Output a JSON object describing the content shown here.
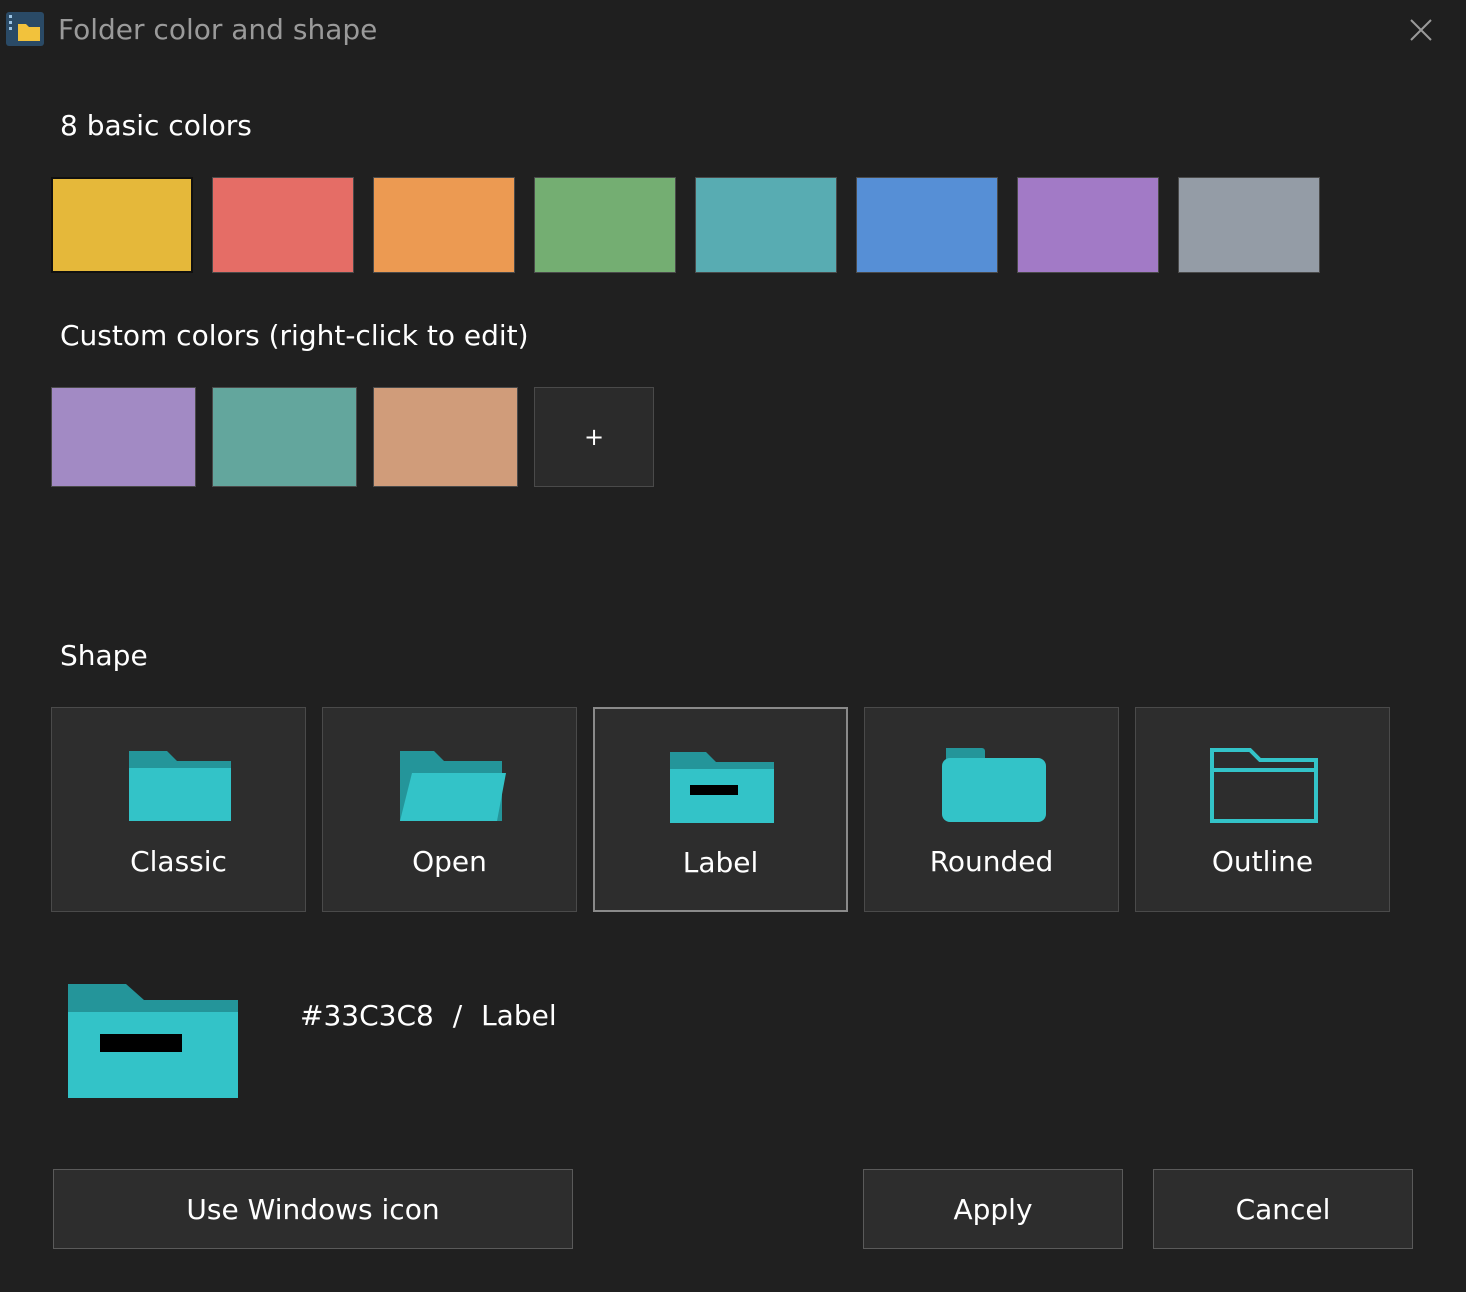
{
  "window": {
    "title": "Folder color and shape",
    "close_icon": "close-icon",
    "app_icon": "folder-app-icon"
  },
  "basic_colors": {
    "label": "8 basic colors",
    "swatches": [
      "#E5B83A",
      "#E56D66",
      "#EC9A52",
      "#74AE72",
      "#58ACB2",
      "#568FD6",
      "#A27AC6",
      "#949CA6"
    ],
    "selected_index": 0
  },
  "custom_colors": {
    "label": "Custom colors (right-click to edit)",
    "swatches": [
      "#A28AC4",
      "#63A69D",
      "#D09C7A"
    ],
    "add_label": "+"
  },
  "shape": {
    "label": "Shape",
    "options": [
      {
        "name": "Classic",
        "icon": "folder-classic-icon"
      },
      {
        "name": "Open",
        "icon": "folder-open-icon"
      },
      {
        "name": "Label",
        "icon": "folder-label-icon"
      },
      {
        "name": "Rounded",
        "icon": "folder-rounded-icon"
      },
      {
        "name": "Outline",
        "icon": "folder-outline-icon"
      }
    ],
    "selected": "Label"
  },
  "preview": {
    "color": "#33C3C8",
    "separator": "/",
    "shape": "Label",
    "icon": "folder-label-icon"
  },
  "buttons": {
    "use_windows_icon": "Use Windows icon",
    "apply": "Apply",
    "cancel": "Cancel"
  },
  "colors": {
    "folder_main": "#33C3C8",
    "folder_tab": "#24959A",
    "background": "#202020"
  }
}
